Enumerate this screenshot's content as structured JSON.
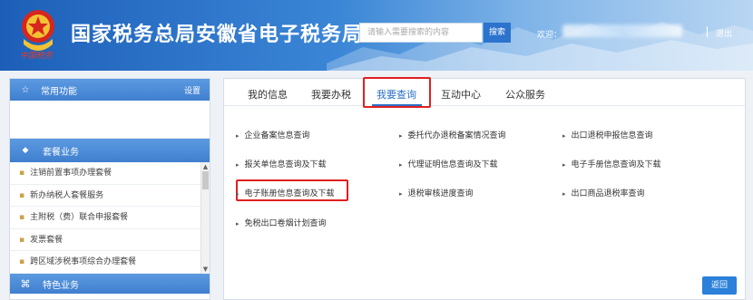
{
  "header": {
    "title": "国家税务总局安徽省电子税务局",
    "logo_text": "中国税务",
    "search_placeholder": "请输入需要搜索的内容",
    "search_button": "搜索",
    "welcome": "欢迎：",
    "logout": "退出"
  },
  "sidebar": {
    "common": {
      "label": "常用功能",
      "settings": "设置"
    },
    "packages": {
      "label": "套餐业务",
      "items": [
        "注销前置事项办理套餐",
        "新办纳税人套餐服务",
        "主附税（费）联合申报套餐",
        "发票套餐",
        "跨区域涉税事项综合办理套餐"
      ]
    },
    "special": {
      "label": "特色业务"
    }
  },
  "main": {
    "tabs": [
      "我的信息",
      "我要办税",
      "我要查询",
      "互动中心",
      "公众服务"
    ],
    "active_tab": "我要查询",
    "links": [
      "企业备案信息查询",
      "委托代办退税备案情况查询",
      "出口退税申报信息查询",
      "报关单信息查询及下载",
      "代理证明信息查询及下载",
      "电子手册信息查询及下载",
      "电子账册信息查询及下载",
      "退税审核进度查询",
      "出口商品退税率查询",
      "免税出口卷烟计划查询"
    ],
    "back_button": "返回"
  },
  "colors": {
    "accent": "#2a6fc6",
    "highlight": "#e02020",
    "header_start": "#1d5fb8"
  }
}
